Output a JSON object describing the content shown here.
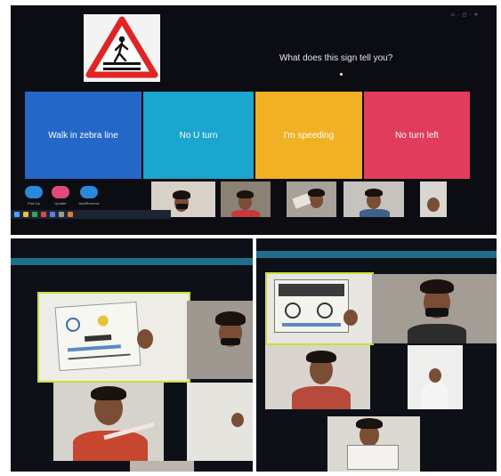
{
  "quiz": {
    "question": "What does this sign tell you?",
    "answers": [
      {
        "label": "Walk in zebra line",
        "color": "#2467c9"
      },
      {
        "label": "No U turn",
        "color": "#1aa6cf"
      },
      {
        "label": "I'm speeding",
        "color": "#f1b125"
      },
      {
        "label": "No turn left",
        "color": "#e13c5b"
      }
    ]
  },
  "toolbar": {
    "buttons": [
      {
        "label": "Pick Up",
        "color": "#2c86d9"
      },
      {
        "label": "Update",
        "color": "#e2497b"
      },
      {
        "label": "Add/Remove",
        "color": "#2c86d9"
      }
    ]
  },
  "colors": {
    "screen_bg": "#0c0d12",
    "meeting_bg": "#0d1016",
    "active_speaker_border": "#c8e03a",
    "window_header": "#1f6f8a"
  },
  "icons": [
    "pedestrian-crossing-sign-icon",
    "mic-icon",
    "video-icon",
    "share-icon"
  ]
}
